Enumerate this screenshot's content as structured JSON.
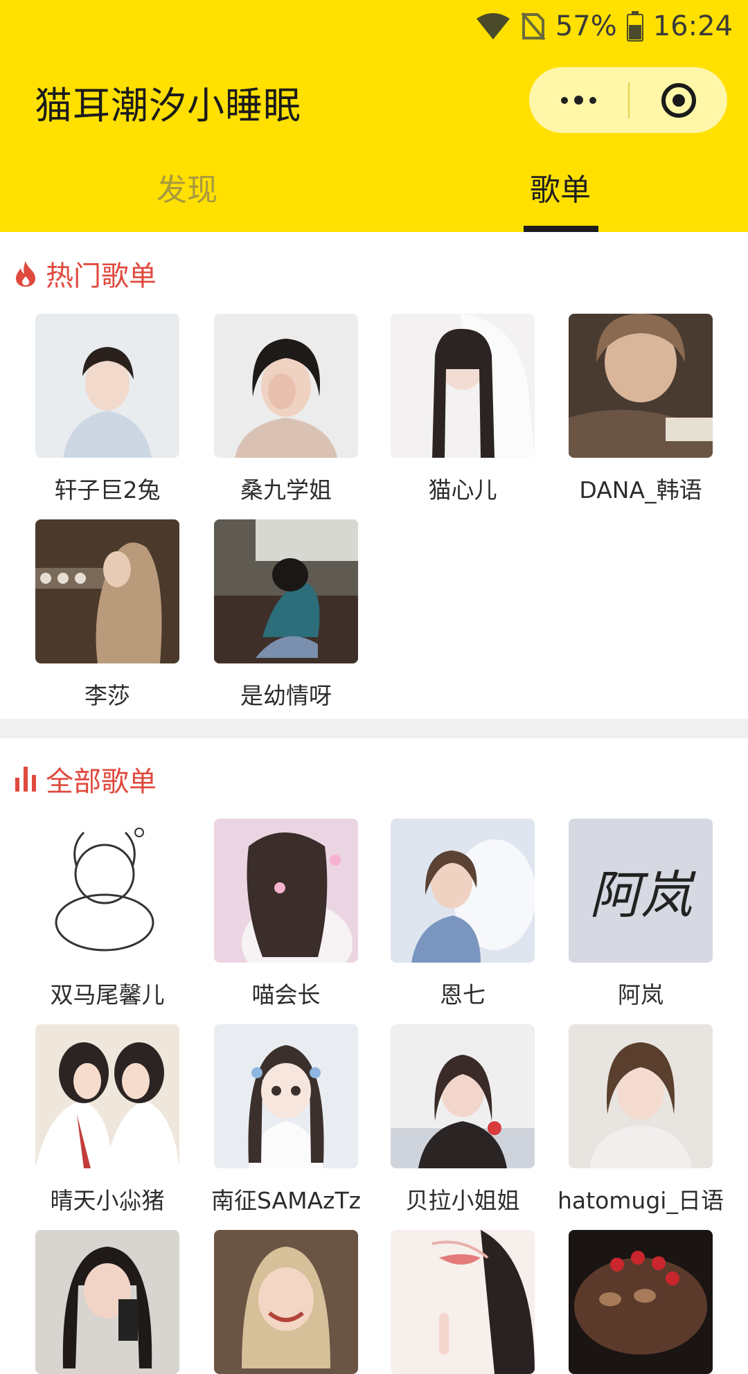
{
  "status_bar": {
    "battery": "57%",
    "time": "16:24"
  },
  "header": {
    "title": "猫耳潮汐小睡眠",
    "tabs": [
      {
        "label": "发现"
      },
      {
        "label": "歌单"
      }
    ],
    "active_tab": "歌单"
  },
  "colors": {
    "accent": "#ffe000",
    "section": "#e0493e"
  },
  "hot": {
    "title": "热门歌单",
    "icon": "fire-icon",
    "items": [
      {
        "name": "轩子巨2兔"
      },
      {
        "name": "桑九学姐"
      },
      {
        "name": "猫心儿"
      },
      {
        "name": "DANA_韩语"
      },
      {
        "name": "李莎"
      },
      {
        "name": "是幼情呀"
      }
    ]
  },
  "all": {
    "title": "全部歌单",
    "icon": "bar-chart-icon",
    "items": [
      {
        "name": "双马尾馨儿"
      },
      {
        "name": "喵会长"
      },
      {
        "name": "恩七"
      },
      {
        "name": "阿岚",
        "cover_text": "阿岚"
      },
      {
        "name": "晴天小尛猪"
      },
      {
        "name": "南征SAMAzTz"
      },
      {
        "name": "贝拉小姐姐"
      },
      {
        "name": "hatomugi_日语"
      },
      {
        "name": ""
      },
      {
        "name": ""
      },
      {
        "name": ""
      },
      {
        "name": ""
      }
    ]
  }
}
